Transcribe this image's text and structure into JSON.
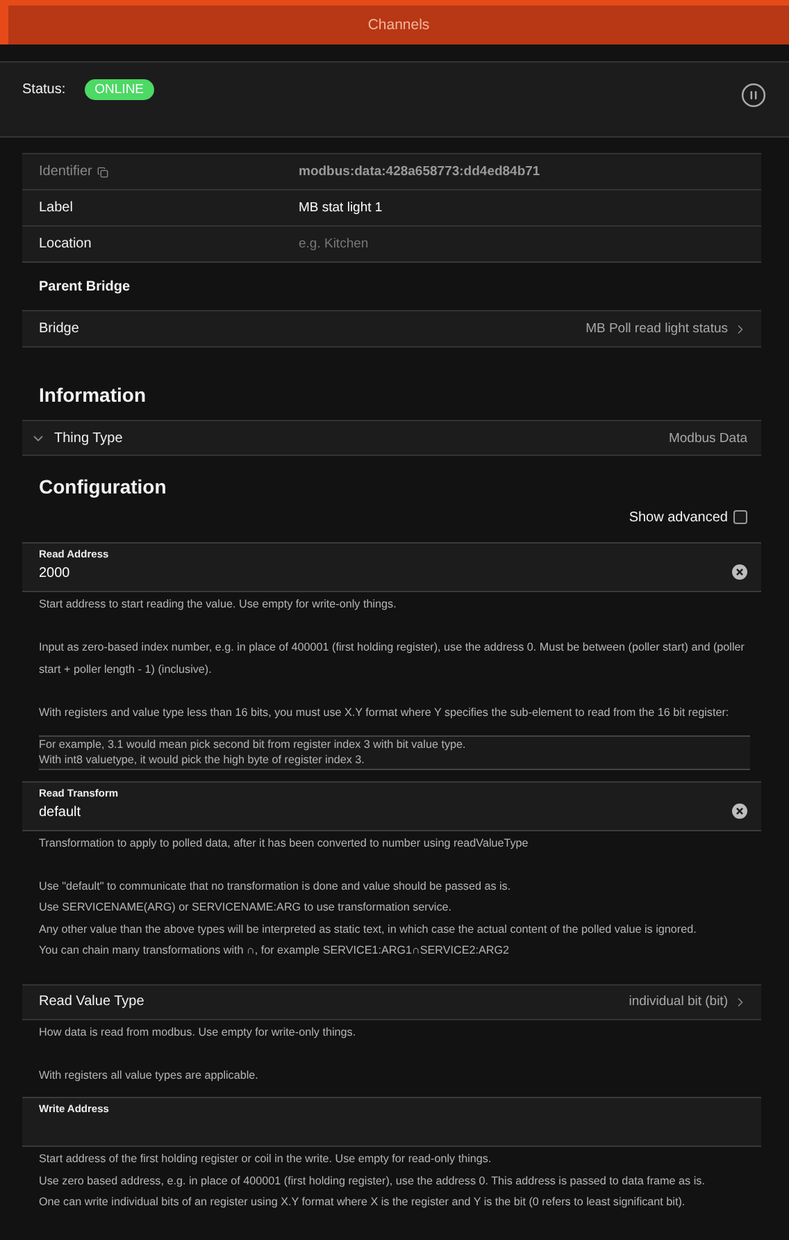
{
  "header": {
    "title": "Channels"
  },
  "status": {
    "label": "Status:",
    "badge": "ONLINE"
  },
  "thing": {
    "rows": [
      {
        "kind": "readonly",
        "label": "Identifier",
        "value": "modbus:data:428a658773:dd4ed84b71"
      },
      {
        "kind": "input",
        "label": "Label",
        "value": "MB stat light 1"
      },
      {
        "kind": "input",
        "label": "Location",
        "placeholder": "e.g. Kitchen"
      }
    ]
  },
  "parent_bridge": {
    "title": "Parent Bridge",
    "row": {
      "label": "Bridge",
      "value": "MB Poll read light status"
    }
  },
  "information": {
    "title": "Information",
    "row": {
      "label": "Thing Type",
      "value": "Modbus Data",
      "expanded": false
    }
  },
  "configuration": {
    "title": "Configuration",
    "show_advanced": {
      "label": "Show advanced",
      "checked": false
    },
    "parameters": [
      {
        "kind": "text",
        "label": "Read Address",
        "value": "2000",
        "description": [
          {
            "kind": "paragraph",
            "lines": [
              "Start address to start reading the value. Use empty for write-only things."
            ]
          },
          {
            "kind": "paragraph",
            "lines": [
              "Input as zero-based index number, e.g. in place of 400001 (first holding register), use the address 0. Must be between (poller start) and (poller start + poller length - 1) (inclusive)."
            ]
          },
          {
            "kind": "paragraph",
            "lines": [
              "With registers and value type less than 16 bits, you must use X.Y format where Y specifies the sub-element to read from the 16 bit register:"
            ]
          },
          {
            "kind": "note",
            "lines": [
              "For example, 3.1 would mean pick second bit from register index 3 with bit value type.",
              "With int8 valuetype, it would pick the high byte of register index 3."
            ]
          }
        ]
      },
      {
        "kind": "text",
        "label": "Read Transform",
        "value": "default",
        "description": [
          {
            "kind": "paragraph",
            "lines": [
              "Transformation to apply to polled data, after it has been converted to number using readValueType"
            ]
          },
          {
            "kind": "paragraph",
            "lines": [
              "Use \"default\" to communicate that no transformation is done and value should be passed as is.",
              "Use SERVICENAME(ARG) or SERVICENAME:ARG to use transformation service.",
              "Any other value than the above types will be interpreted as static text, in which case the actual content of the polled value is ignored.",
              "You can chain many transformations with ∩, for example SERVICE1:ARG1∩SERVICE2:ARG2"
            ]
          }
        ]
      },
      {
        "kind": "select",
        "label": "Read Value Type",
        "value": "individual bit (bit)",
        "description": [
          {
            "kind": "paragraph",
            "lines": [
              "How data is read from modbus. Use empty for write-only things."
            ]
          },
          {
            "kind": "paragraph",
            "lines": [
              "With registers all value types are applicable."
            ]
          }
        ]
      },
      {
        "kind": "text",
        "label": "Write Address",
        "description": [
          {
            "kind": "paragraph",
            "lines": [
              "Start address of the first holding register or coil in the write. Use empty for read-only things.",
              "Use zero based address, e.g. in place of 400001 (first holding register), use the address 0. This address is passed to data frame as is.",
              "One can write individual bits of an register using X.Y format where X is the register and Y is the bit (0 refers to least significant bit)."
            ]
          }
        ]
      }
    ]
  }
}
